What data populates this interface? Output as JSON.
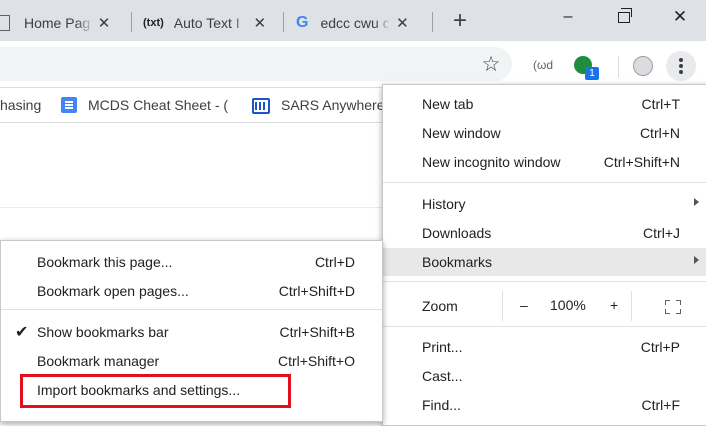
{
  "tabs": [
    {
      "title": "Home Pag",
      "icon": "page-icon"
    },
    {
      "title": "Auto Text I",
      "icon": "text-expander-icon",
      "icon_text": "(txt)"
    },
    {
      "title": "edcc cwu c",
      "icon": "google-icon",
      "icon_text": "G"
    }
  ],
  "new_tab_symbol": "+",
  "window_controls": {
    "minimize": "–",
    "close": "✕"
  },
  "toolbar": {
    "star_symbol": "☆",
    "ext_signal_text": "(ωd",
    "ext_badge": "1"
  },
  "bookmarks_bar": [
    {
      "label": "hasing",
      "icon": "none"
    },
    {
      "label": "MCDS Cheat Sheet - (",
      "icon": "doc-icon"
    },
    {
      "label": "SARS Anywhere",
      "icon": "calendar-icon"
    }
  ],
  "chrome_menu": {
    "items": [
      {
        "label": "New tab",
        "shortcut": "Ctrl+T"
      },
      {
        "label": "New window",
        "shortcut": "Ctrl+N"
      },
      {
        "label": "New incognito window",
        "shortcut": "Ctrl+Shift+N"
      },
      {
        "label": "History",
        "shortcut": ""
      },
      {
        "label": "Downloads",
        "shortcut": "Ctrl+J"
      },
      {
        "label": "Bookmarks",
        "shortcut": ""
      },
      {
        "label": "Zoom",
        "shortcut": ""
      },
      {
        "label": "Print...",
        "shortcut": "Ctrl+P"
      },
      {
        "label": "Cast...",
        "shortcut": ""
      },
      {
        "label": "Find...",
        "shortcut": "Ctrl+F"
      }
    ],
    "zoom": {
      "minus": "–",
      "level": "100%",
      "plus": "+"
    }
  },
  "bookmarks_submenu": {
    "items": [
      {
        "label": "Bookmark this page...",
        "shortcut": "Ctrl+D"
      },
      {
        "label": "Bookmark open pages...",
        "shortcut": "Ctrl+Shift+D"
      },
      {
        "label": "Show bookmarks bar",
        "shortcut": "Ctrl+Shift+B",
        "checked": true
      },
      {
        "label": "Bookmark manager",
        "shortcut": "Ctrl+Shift+O"
      },
      {
        "label": "Import bookmarks and settings...",
        "shortcut": ""
      }
    ],
    "check_symbol": "✔"
  },
  "colors": {
    "tabstrip": "#dee1e6",
    "highlight_outline": "#e0101c",
    "avatar_green": "#1e8e3e",
    "badge_blue": "#1a73e8"
  }
}
